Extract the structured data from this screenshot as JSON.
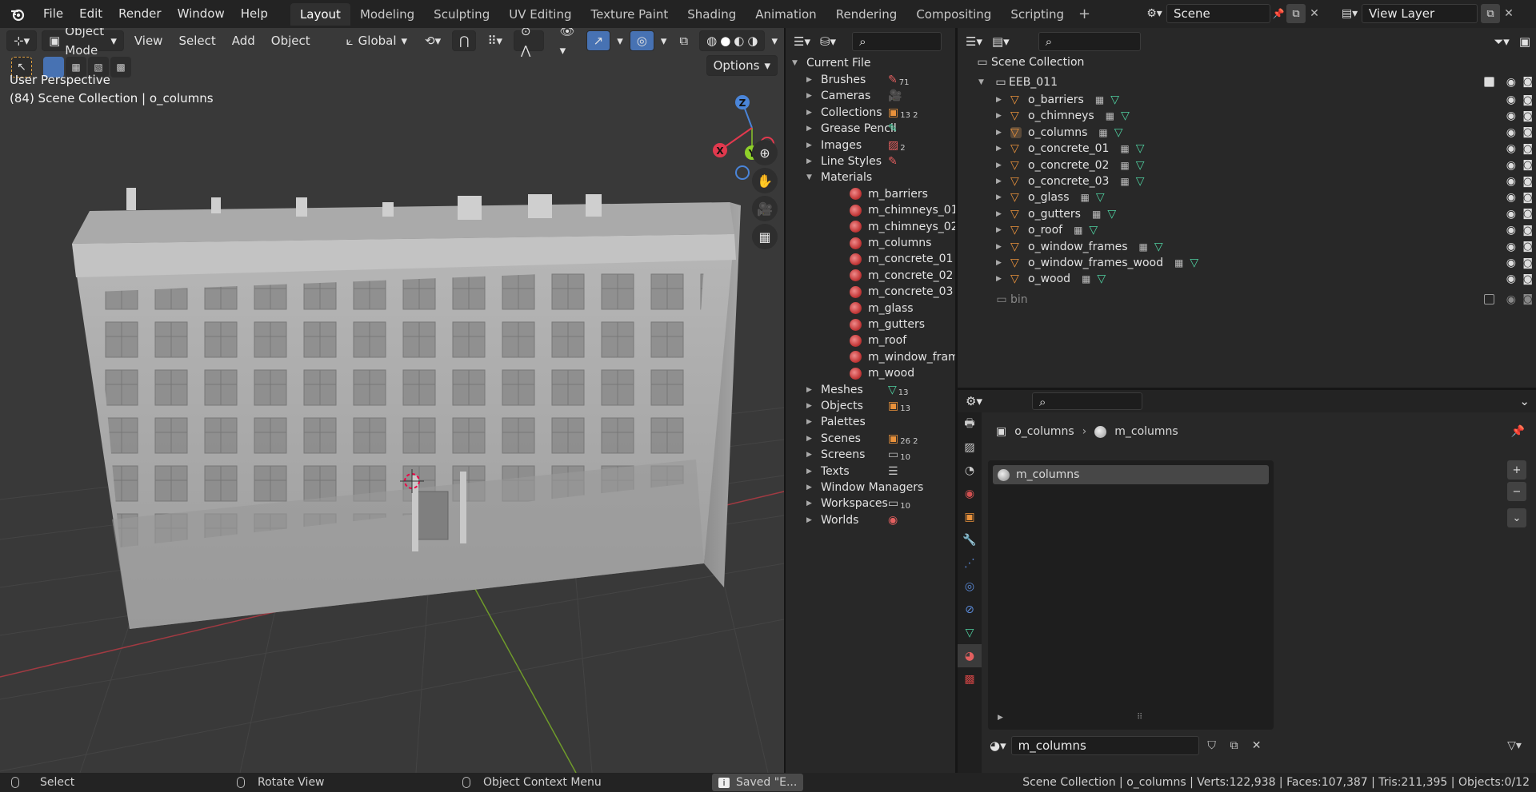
{
  "topbar": {
    "menus": [
      "File",
      "Edit",
      "Render",
      "Window",
      "Help"
    ],
    "workspaces": [
      "Layout",
      "Modeling",
      "Sculpting",
      "UV Editing",
      "Texture Paint",
      "Shading",
      "Animation",
      "Rendering",
      "Compositing",
      "Scripting"
    ],
    "active_workspace": "Layout",
    "scene": "Scene",
    "view_layer": "View Layer"
  },
  "viewport": {
    "mode": "Object Mode",
    "menus": [
      "View",
      "Select",
      "Add",
      "Object"
    ],
    "transform_orientation": "Global",
    "options_label": "Options",
    "perspective_label": "User Perspective",
    "collection_label": "(84) Scene Collection | o_columns",
    "gizmo_axes": {
      "z": "Z",
      "y": "Y",
      "x": "X"
    },
    "colors": {
      "x_axis": "#e2394e",
      "y_axis": "#8fd12a",
      "z_axis": "#4a85d9",
      "grid": "#4a4a4a"
    }
  },
  "blend_file": {
    "root": "Current File",
    "items": [
      {
        "label": "Brushes",
        "badge": "71"
      },
      {
        "label": "Cameras",
        "badge": ""
      },
      {
        "label": "Collections",
        "badge": "13 2"
      },
      {
        "label": "Grease Pencil",
        "badge": ""
      },
      {
        "label": "Images",
        "badge": "2"
      },
      {
        "label": "Line Styles",
        "badge": ""
      },
      {
        "label": "Materials",
        "badge": "",
        "expanded": true
      },
      {
        "label": "Meshes",
        "badge": "13"
      },
      {
        "label": "Objects",
        "badge": "13"
      },
      {
        "label": "Palettes",
        "badge": ""
      },
      {
        "label": "Scenes",
        "badge": "26 2"
      },
      {
        "label": "Screens",
        "badge": "10"
      },
      {
        "label": "Texts",
        "badge": ""
      },
      {
        "label": "Window Managers",
        "badge": ""
      },
      {
        "label": "Workspaces",
        "badge": "10"
      },
      {
        "label": "Worlds",
        "badge": ""
      }
    ],
    "materials": [
      "m_barriers",
      "m_chimneys_01",
      "m_chimneys_02",
      "m_columns",
      "m_concrete_01",
      "m_concrete_02",
      "m_concrete_03",
      "m_glass",
      "m_gutters",
      "m_roof",
      "m_window_frames_wood",
      "m_wood"
    ]
  },
  "scene_outliner": {
    "root": "Scene Collection",
    "collection": "EEB_011",
    "objects": [
      "o_barriers",
      "o_chimneys",
      "o_columns",
      "o_concrete_01",
      "o_concrete_02",
      "o_concrete_03",
      "o_glass",
      "o_gutters",
      "o_roof",
      "o_window_frames",
      "o_window_frames_wood",
      "o_wood"
    ],
    "selected": "o_columns",
    "bin": "bin"
  },
  "properties": {
    "breadcrumb_object": "o_columns",
    "breadcrumb_material": "m_columns",
    "slot": "m_columns",
    "material_field": "m_columns"
  },
  "statusbar": {
    "select": "Select",
    "rotate": "Rotate View",
    "context": "Object Context Menu",
    "saved": "Saved \"E...",
    "stats": "Scene Collection | o_columns | Verts:122,938 | Faces:107,387 | Tris:211,395 | Objects:0/12"
  }
}
